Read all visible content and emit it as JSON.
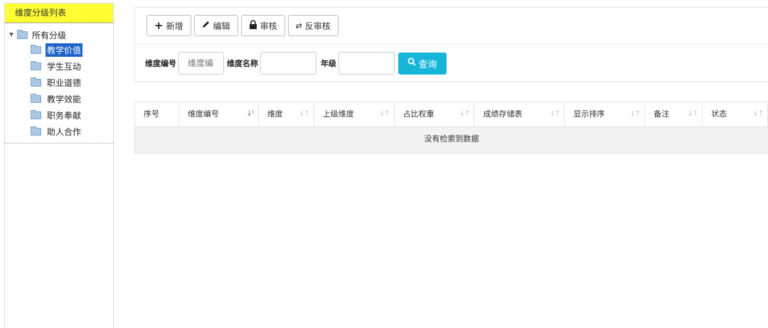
{
  "left": {
    "title": "维度分级列表",
    "tree": {
      "root_label": "所有分级",
      "items": [
        {
          "label": "教学价值",
          "selected": true
        },
        {
          "label": "学生互动",
          "selected": false
        },
        {
          "label": "职业道德",
          "selected": false
        },
        {
          "label": "教学效能",
          "selected": false
        },
        {
          "label": "职务奉献",
          "selected": false
        },
        {
          "label": "助人合作",
          "selected": false
        }
      ]
    }
  },
  "toolbar": {
    "add_label": "新增",
    "edit_label": "编辑",
    "audit_label": "审核",
    "unaudit_label": "反审核"
  },
  "filter": {
    "code_label": "维度编号",
    "code_placeholder": "维度编",
    "name_label": "维度名称",
    "grade_label": "年级",
    "search_label": "查询"
  },
  "table": {
    "columns": [
      "序号",
      "维度编号",
      "维度",
      "上级维度",
      "占比权重",
      "成绩存储表",
      "显示排序",
      "备注",
      "状态"
    ],
    "empty_text": "没有检索到数据"
  },
  "colors": {
    "title_bg": "#ffff33",
    "selected_bg": "#1e64c8",
    "search_btn": "#17b5d8"
  }
}
